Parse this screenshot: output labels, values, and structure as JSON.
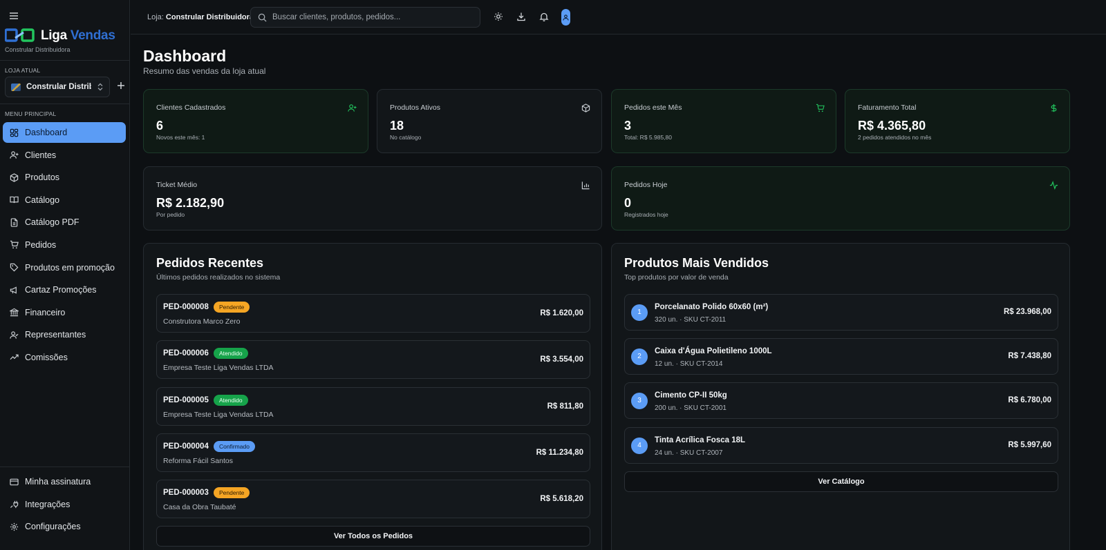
{
  "sidebar": {
    "brand": {
      "liga": "Liga",
      "vendas": "Vendas",
      "subtitle": "Constrular Distribuidora"
    },
    "current_store_label": "LOJA ATUAL",
    "store_name": "Constrular Distrib...",
    "menu_label": "MENU PRINCIPAL",
    "nav": [
      {
        "label": "Dashboard",
        "icon": "dashboard-icon"
      },
      {
        "label": "Clientes",
        "icon": "user-plus-icon"
      },
      {
        "label": "Produtos",
        "icon": "package-icon"
      },
      {
        "label": "Catálogo",
        "icon": "book-open-icon"
      },
      {
        "label": "Catálogo PDF",
        "icon": "file-text-icon"
      },
      {
        "label": "Pedidos",
        "icon": "cart-icon"
      },
      {
        "label": "Produtos em promoção",
        "icon": "tag-icon"
      },
      {
        "label": "Cartaz Promoções",
        "icon": "megaphone-icon"
      },
      {
        "label": "Financeiro",
        "icon": "bank-icon"
      },
      {
        "label": "Representantes",
        "icon": "user-check-icon"
      },
      {
        "label": "Comissões",
        "icon": "trending-up-icon"
      }
    ],
    "bottom_nav": [
      {
        "label": "Minha assinatura",
        "icon": "credit-card-icon"
      },
      {
        "label": "Integrações",
        "icon": "plug-icon"
      },
      {
        "label": "Configurações",
        "icon": "gear-icon"
      }
    ]
  },
  "header": {
    "store_prefix": "Loja:",
    "store_name": "Constrular Distribuidora",
    "search_placeholder": "Buscar clientes, produtos, pedidos..."
  },
  "page": {
    "title": "Dashboard",
    "subtitle": "Resumo das vendas da loja atual"
  },
  "stats": [
    {
      "label": "Clientes Cadastrados",
      "value": "6",
      "sub": "Novos este mês: 1",
      "icon": "user-plus-icon"
    },
    {
      "label": "Produtos Ativos",
      "value": "18",
      "sub": "No catálogo",
      "icon": "package-icon"
    },
    {
      "label": "Pedidos este Mês",
      "value": "3",
      "sub": "Total: R$ 5.985,80",
      "icon": "cart-icon"
    },
    {
      "label": "Faturamento Total",
      "value": "R$ 4.365,80",
      "sub": "2 pedidos atendidos no mês",
      "icon": "dollar-icon"
    },
    {
      "label": "Ticket Médio",
      "value": "R$ 2.182,90",
      "sub": "Por pedido",
      "icon": "bar-chart-icon"
    },
    {
      "label": "Pedidos Hoje",
      "value": "0",
      "sub": "Registrados hoje",
      "icon": "activity-icon"
    }
  ],
  "colors": {
    "accent": "#5b9cf5",
    "green": "#22c55e",
    "pending": "#f5a524",
    "attended": "#16a34a"
  },
  "recent_orders": {
    "title": "Pedidos Recentes",
    "subtitle": "Últimos pedidos realizados no sistema",
    "button": "Ver Todos os Pedidos",
    "rows": [
      {
        "id": "PED-000008",
        "status": "Pendente",
        "client": "Construtora Marco Zero",
        "total": "R$ 1.620,00"
      },
      {
        "id": "PED-000006",
        "status": "Atendido",
        "client": "Empresa Teste Liga Vendas LTDA",
        "total": "R$ 3.554,00"
      },
      {
        "id": "PED-000005",
        "status": "Atendido",
        "client": "Empresa Teste Liga Vendas LTDA",
        "total": "R$ 811,80"
      },
      {
        "id": "PED-000004",
        "status": "Confirmado",
        "client": "Reforma Fácil Santos",
        "total": "R$ 11.234,80"
      },
      {
        "id": "PED-000003",
        "status": "Pendente",
        "client": "Casa da Obra Taubaté",
        "total": "R$ 5.618,20"
      }
    ]
  },
  "top_products": {
    "title": "Produtos Mais Vendidos",
    "subtitle": "Top produtos por valor de venda",
    "button": "Ver Catálogo",
    "rows": [
      {
        "rank": "1",
        "name": "Porcelanato Polido 60x60 (m²)",
        "meta": "320 un. · SKU CT-2011",
        "total": "R$ 23.968,00"
      },
      {
        "rank": "2",
        "name": "Caixa d'Água Polietileno 1000L",
        "meta": "12 un. · SKU CT-2014",
        "total": "R$ 7.438,80"
      },
      {
        "rank": "3",
        "name": "Cimento CP-II 50kg",
        "meta": "200 un. · SKU CT-2001",
        "total": "R$ 6.780,00"
      },
      {
        "rank": "4",
        "name": "Tinta Acrílica Fosca 18L",
        "meta": "24 un. · SKU CT-2007",
        "total": "R$ 5.997,60"
      }
    ]
  }
}
